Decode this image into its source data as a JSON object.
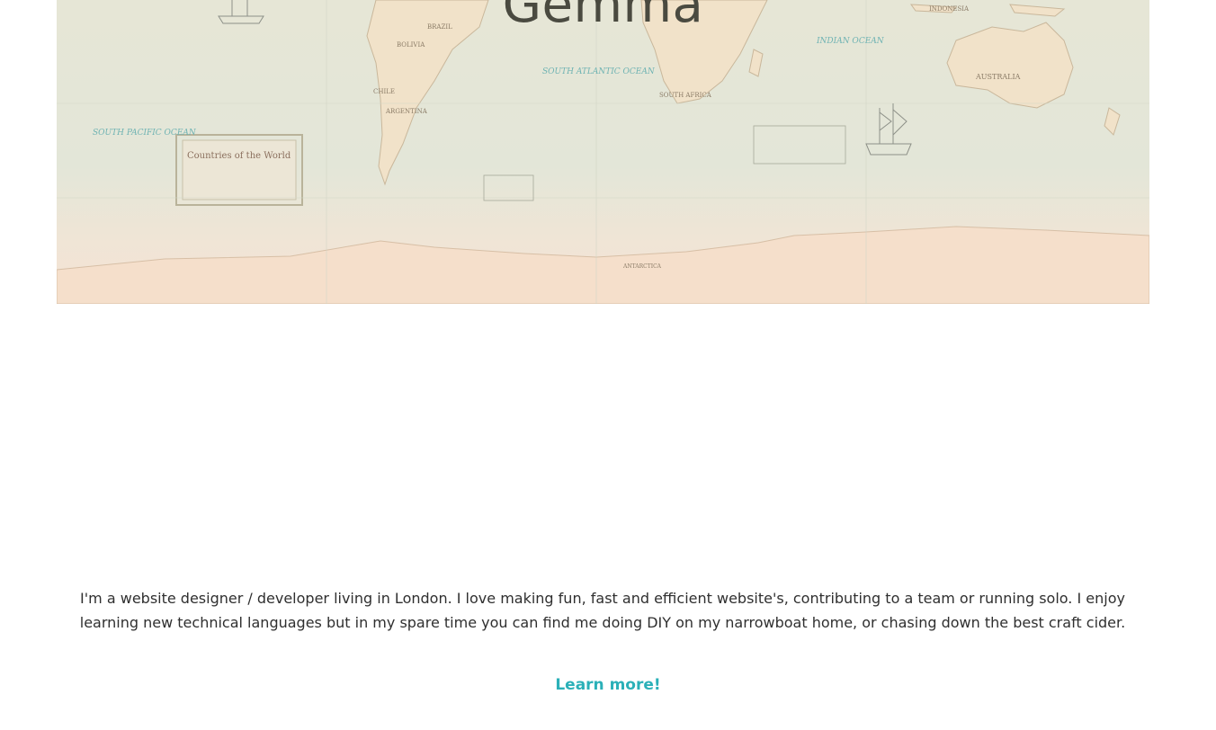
{
  "hero": {
    "title": "Gemma",
    "map_labels": {
      "brazil": "BRAZIL",
      "argentina": "ARGENTINA",
      "bolivia": "BOLIVIA",
      "chile": "CHILE",
      "south_atlantic": "SOUTH ATLANTIC OCEAN",
      "indian_ocean": "INDIAN OCEAN",
      "south_pacific": "SOUTH PACIFIC OCEAN",
      "australia": "AUSTRALIA",
      "south_africa": "SOUTH AFRICA",
      "antarctica": "ANTARCTICA",
      "cartouche": "Countries of the World",
      "indonesia": "INDONESIA"
    }
  },
  "about": {
    "bio": "I'm a website designer / developer living in London. I love making fun, fast and efficient website's, contributing to a team or running solo. I enjoy learning new technical languages but in my spare time you can find me doing DIY on my narrowboat home, or chasing down the best craft cider.",
    "link_label": "Learn more!"
  },
  "colors": {
    "accent": "#2bb0b8",
    "text": "#2f2f2f",
    "title": "#4a4a40"
  }
}
